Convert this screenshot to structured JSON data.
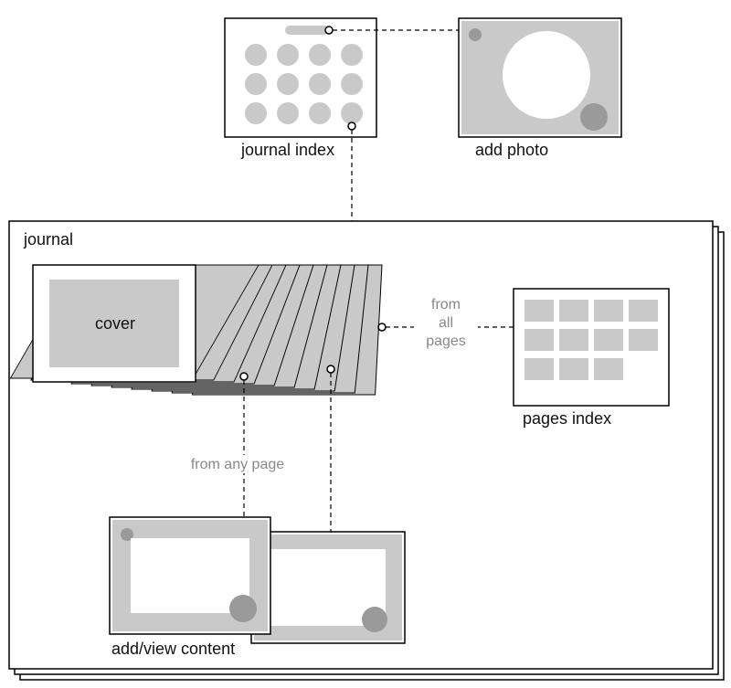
{
  "labels": {
    "journal_index": "journal index",
    "add_photo": "add photo",
    "journal": "journal",
    "cover": "cover",
    "pages_index": "pages index",
    "add_view_content": "add/view content"
  },
  "annotations": {
    "from_all_pages_l1": "from",
    "from_all_pages_l2": "all",
    "from_all_pages_l3": "pages",
    "from_any_page": "from any page"
  },
  "diagram": {
    "nodes": [
      {
        "id": "journal-index",
        "type": "grid-of-dots",
        "has_title_bar": true
      },
      {
        "id": "add-photo",
        "type": "photo-placeholder"
      },
      {
        "id": "journal",
        "type": "stacked-container"
      },
      {
        "id": "cover",
        "type": "cover-page"
      },
      {
        "id": "page-stack",
        "type": "fanned-pages"
      },
      {
        "id": "pages-index",
        "type": "thumbnail-grid"
      },
      {
        "id": "add-view-content",
        "type": "photo-placeholder-pair"
      }
    ],
    "edges": [
      {
        "from": "journal-index.title-bar",
        "to": "add-photo"
      },
      {
        "from": "journal-index.item",
        "to": "journal"
      },
      {
        "from": "page-stack.last-page",
        "to": "pages-index",
        "label": "from all pages"
      },
      {
        "from": "page-stack.any-page",
        "to": "add-view-content",
        "label": "from any page"
      }
    ]
  }
}
